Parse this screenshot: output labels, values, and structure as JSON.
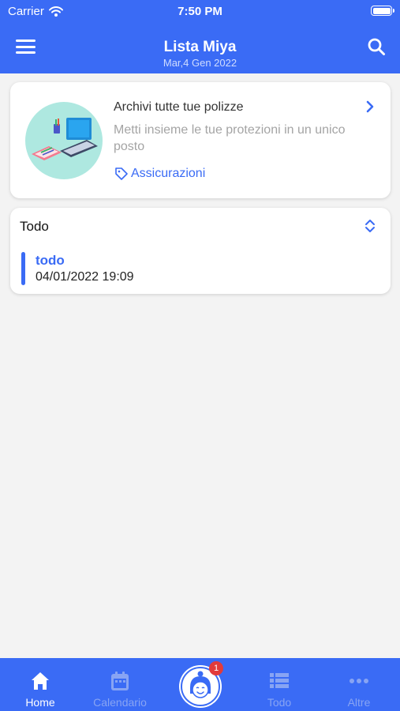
{
  "status_bar": {
    "carrier": "Carrier",
    "time": "7:50 PM"
  },
  "header": {
    "title": "Lista Miya",
    "subtitle": "Mar,4 Gen 2022"
  },
  "promo_card": {
    "title": "Archivi tutte tue polizze",
    "description": "Metti insieme le tue protezioni in un unico posto",
    "tag": "Assicurazioni"
  },
  "todo_section": {
    "title": "Todo",
    "items": [
      {
        "name": "todo",
        "datetime": "04/01/2022 19:09"
      }
    ]
  },
  "tabbar": {
    "tabs": [
      {
        "label": "Home",
        "icon": "home-icon",
        "active": true
      },
      {
        "label": "Calendario",
        "icon": "calendar-icon",
        "active": false
      },
      {
        "label": "",
        "icon": "assistant-avatar-icon",
        "active": false
      },
      {
        "label": "Todo",
        "icon": "list-icon",
        "active": false
      },
      {
        "label": "Altre",
        "icon": "more-icon",
        "active": false
      }
    ],
    "badge": "1"
  },
  "colors": {
    "primary": "#3a6bf5",
    "background": "#f3f3f3",
    "badge": "#e23b3b"
  }
}
